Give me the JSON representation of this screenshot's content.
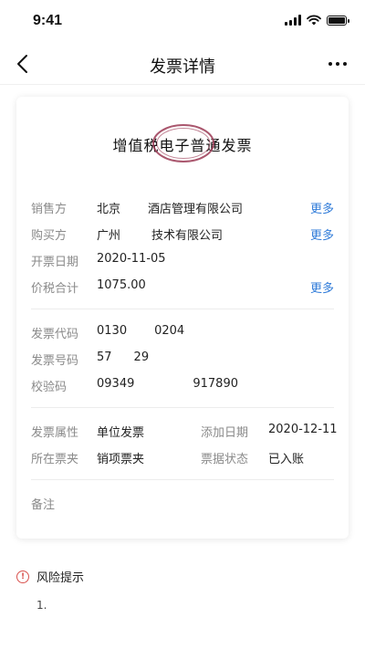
{
  "status": {
    "time": "9:41"
  },
  "header": {
    "title": "发票详情"
  },
  "invoice": {
    "title": "增值税电子普通发票",
    "seller": {
      "label": "销售方",
      "value_a": "北京",
      "value_b": "酒店管理有限公司",
      "more": "更多"
    },
    "buyer": {
      "label": "购买方",
      "value_a": "广州",
      "value_b": "技术有限公司",
      "more": "更多"
    },
    "issue_date": {
      "label": "开票日期",
      "value": "2020-11-05"
    },
    "total": {
      "label": "价税合计",
      "value": "1075.00",
      "more": "更多"
    },
    "code": {
      "label": "发票代码",
      "value_a": "0130",
      "value_b": "0204"
    },
    "number": {
      "label": "发票号码",
      "value_a": "57",
      "value_b": "29"
    },
    "check_code": {
      "label": "校验码",
      "value_a": "09349",
      "value_b": "917890"
    },
    "attribute": {
      "label": "发票属性",
      "value": "单位发票"
    },
    "add_date": {
      "label": "添加日期",
      "value": "2020-12-11"
    },
    "folder": {
      "label": "所在票夹",
      "value": "销项票夹"
    },
    "state": {
      "label": "票据状态",
      "value": "已入账"
    },
    "remark": {
      "label": "备注"
    }
  },
  "risk": {
    "title": "风险提示",
    "item_index": "1."
  },
  "colors": {
    "link": "#2f7bd9",
    "stamp": "#9b3a55",
    "warning": "#d9534f"
  }
}
